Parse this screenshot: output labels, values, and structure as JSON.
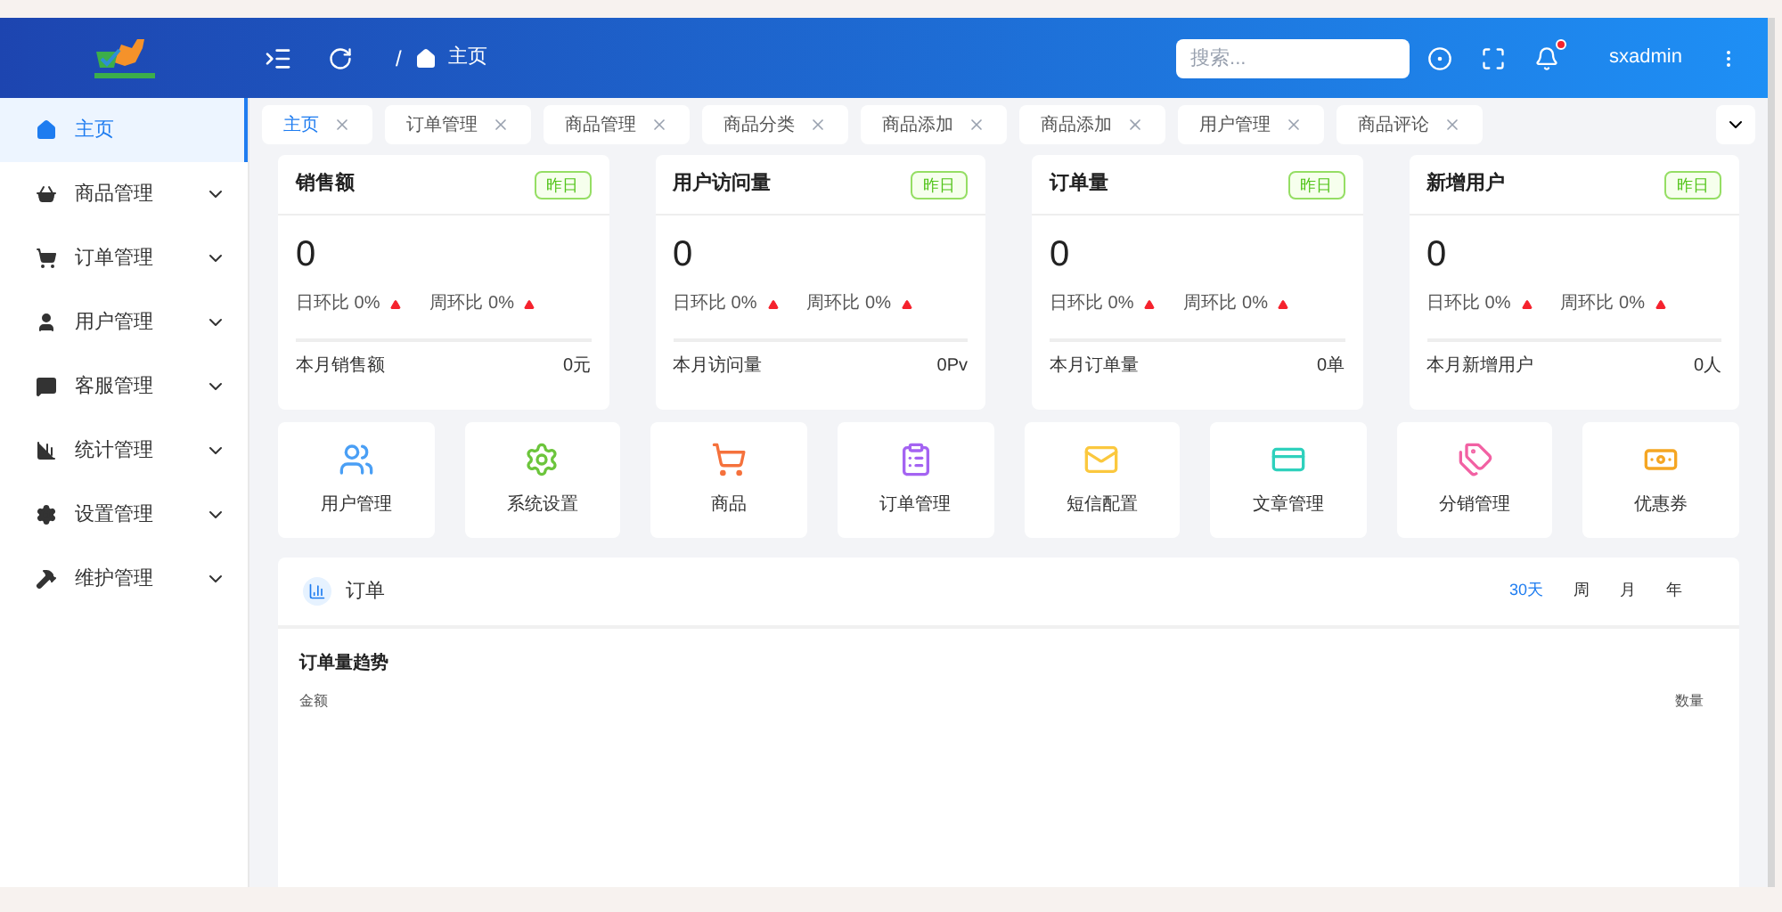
{
  "header": {
    "breadcrumb_separator": "/",
    "breadcrumb": "主页",
    "search": {
      "placeholder": "搜索..."
    },
    "notification": {
      "unread": true
    },
    "user": "sxadmin"
  },
  "sidebar": {
    "items": [
      {
        "label": "主页",
        "selected": true,
        "expandable": false
      },
      {
        "label": "商品管理",
        "selected": false,
        "expandable": true
      },
      {
        "label": "订单管理",
        "selected": false,
        "expandable": true
      },
      {
        "label": "用户管理",
        "selected": false,
        "expandable": true
      },
      {
        "label": "客服管理",
        "selected": false,
        "expandable": true
      },
      {
        "label": "统计管理",
        "selected": false,
        "expandable": true
      },
      {
        "label": "设置管理",
        "selected": false,
        "expandable": true
      },
      {
        "label": "维护管理",
        "selected": false,
        "expandable": true
      }
    ]
  },
  "tabs": [
    {
      "label": "主页",
      "selected": true
    },
    {
      "label": "订单管理",
      "selected": false
    },
    {
      "label": "商品管理",
      "selected": false
    },
    {
      "label": "商品分类",
      "selected": false
    },
    {
      "label": "商品添加",
      "selected": false
    },
    {
      "label": "商品添加",
      "selected": false
    },
    {
      "label": "用户管理",
      "selected": false
    },
    {
      "label": "商品评论",
      "selected": false
    }
  ],
  "stat_cards": [
    {
      "title": "销售额",
      "badge": "昨日",
      "value": "0",
      "day_ratio": "日环比 0%",
      "week_ratio": "周环比 0%",
      "footer_label": "本月销售额",
      "footer_value": "0元"
    },
    {
      "title": "用户访问量",
      "badge": "昨日",
      "value": "0",
      "day_ratio": "日环比 0%",
      "week_ratio": "周环比 0%",
      "footer_label": "本月访问量",
      "footer_value": "0Pv"
    },
    {
      "title": "订单量",
      "badge": "昨日",
      "value": "0",
      "day_ratio": "日环比 0%",
      "week_ratio": "周环比 0%",
      "footer_label": "本月订单量",
      "footer_value": "0单"
    },
    {
      "title": "新增用户",
      "badge": "昨日",
      "value": "0",
      "day_ratio": "日环比 0%",
      "week_ratio": "周环比 0%",
      "footer_label": "本月新增用户",
      "footer_value": "0人"
    }
  ],
  "shortcuts": [
    {
      "label": "用户管理",
      "color": "#4a9ff5"
    },
    {
      "label": "系统设置",
      "color": "#6cc53c"
    },
    {
      "label": "商品",
      "color": "#f5713c"
    },
    {
      "label": "订单管理",
      "color": "#a463f2"
    },
    {
      "label": "短信配置",
      "color": "#fbc83e"
    },
    {
      "label": "文章管理",
      "color": "#2fd1bd"
    },
    {
      "label": "分销管理",
      "color": "#f261a3"
    },
    {
      "label": "优惠券",
      "color": "#f5a623"
    }
  ],
  "orders_panel": {
    "title": "订单",
    "ranges": [
      {
        "label": "30天",
        "selected": true
      },
      {
        "label": "周",
        "selected": false
      },
      {
        "label": "月",
        "selected": false
      },
      {
        "label": "年",
        "selected": false
      }
    ],
    "chart_title": "订单量趋势",
    "left_axis_label": "金额",
    "right_axis_label": "数量"
  }
}
